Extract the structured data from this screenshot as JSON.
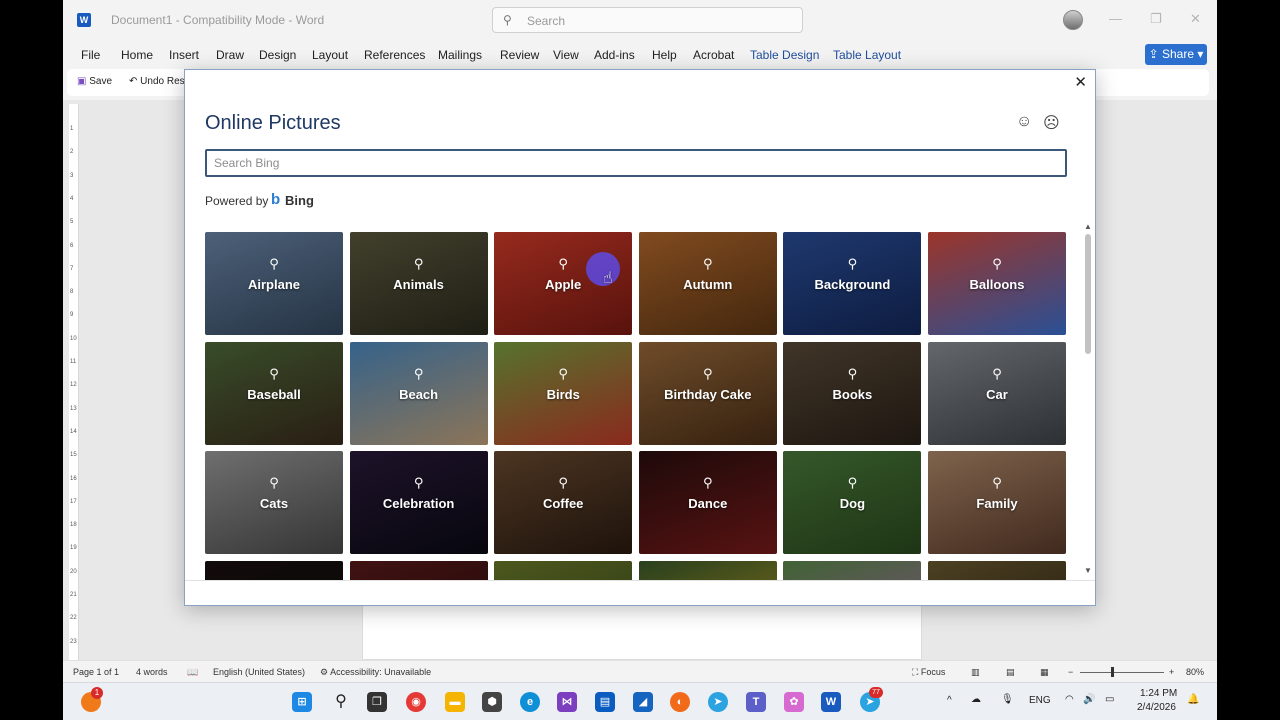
{
  "window": {
    "title": "Document1  -  Compatibility Mode  -  Word",
    "search_placeholder": "Search",
    "minimize": "—",
    "restore": "❐",
    "close": "✕"
  },
  "menu": {
    "items": [
      "File",
      "Home",
      "Insert",
      "Draw",
      "Design",
      "Layout",
      "References",
      "Mailings",
      "Review",
      "View",
      "Add-ins",
      "Help",
      "Acrobat"
    ],
    "context_tabs": [
      "Table Design",
      "Table Layout"
    ],
    "share_label": "Share"
  },
  "quick_toolbar": {
    "save_label": "Save",
    "undo_label": "Undo Res"
  },
  "ruler": {
    "ticks": [
      "1",
      "2",
      "3",
      "4",
      "5",
      "6",
      "7",
      "8",
      "9",
      "10",
      "11",
      "12",
      "13",
      "14",
      "15",
      "16",
      "17",
      "18",
      "19",
      "20",
      "21",
      "22",
      "23"
    ]
  },
  "dialog": {
    "title": "Online Pictures",
    "close_label": "✕",
    "smile_label": "☺",
    "frown_label": "☹",
    "search_placeholder": "Search Bing",
    "powered_by": "Powered by",
    "bing_label": "Bing",
    "magnifier": "⚲",
    "scroll_up": "▲",
    "scroll_down": "▼",
    "tiles": [
      {
        "label": "Airplane",
        "colors": [
          "#6b86a8",
          "#34485e"
        ]
      },
      {
        "label": "Animals",
        "colors": [
          "#5c5a3e",
          "#2b2a1d"
        ]
      },
      {
        "label": "Apple",
        "colors": [
          "#d13b2a",
          "#7a1a12"
        ]
      },
      {
        "label": "Autumn",
        "colors": [
          "#b3682c",
          "#5e3714"
        ]
      },
      {
        "label": "Background",
        "colors": [
          "#2a4f9a",
          "#14285a"
        ]
      },
      {
        "label": "Balloons",
        "colors": [
          "#d84a3a",
          "#3a6fd0"
        ]
      },
      {
        "label": "Baseball",
        "colors": [
          "#4e6b3a",
          "#3a2a1c"
        ]
      },
      {
        "label": "Beach",
        "colors": [
          "#4b89c0",
          "#c2a27a"
        ]
      },
      {
        "label": "Birds",
        "colors": [
          "#78a040",
          "#c03a2a"
        ]
      },
      {
        "label": "Birthday Cake",
        "colors": [
          "#9a6a3a",
          "#4a2e16"
        ]
      },
      {
        "label": "Books",
        "colors": [
          "#5a4a38",
          "#2a2018"
        ]
      },
      {
        "label": "Car",
        "colors": [
          "#8a8f96",
          "#3e4348"
        ]
      },
      {
        "label": "Cats",
        "colors": [
          "#9a9a9a",
          "#4a4a4a"
        ]
      },
      {
        "label": "Celebration",
        "colors": [
          "#2a1a3a",
          "#0a0a14"
        ]
      },
      {
        "label": "Coffee",
        "colors": [
          "#6a4a30",
          "#2a1a10"
        ]
      },
      {
        "label": "Dance",
        "colors": [
          "#2a0e0e",
          "#7a1a1a"
        ]
      },
      {
        "label": "Dog",
        "colors": [
          "#4a7a3a",
          "#2a4a1e"
        ]
      },
      {
        "label": "Family",
        "colors": [
          "#b08a6a",
          "#5a3a2a"
        ]
      },
      {
        "label": "",
        "colors": [
          "#1a1010",
          "#0a0a0a"
        ]
      },
      {
        "label": "",
        "colors": [
          "#5a1a1a",
          "#2a0a0a"
        ]
      },
      {
        "label": "",
        "colors": [
          "#6a7a2a",
          "#3a4a1a"
        ]
      },
      {
        "label": "",
        "colors": [
          "#3a5a2a",
          "#c0a020"
        ]
      },
      {
        "label": "",
        "colors": [
          "#5a8a4a",
          "#b06ab0"
        ]
      },
      {
        "label": "",
        "colors": [
          "#6a5a30",
          "#2a2010"
        ]
      }
    ]
  },
  "status": {
    "page": "Page 1 of 1",
    "words": "4 words",
    "language": "English (United States)",
    "accessibility": "Accessibility: Unavailable",
    "focus": "Focus",
    "zoom_minus": "−",
    "zoom_plus": "+",
    "zoom": "80%"
  },
  "taskbar": {
    "notification_badge": "1",
    "telegram_badge": "77",
    "chevron": "^",
    "language": "ENG",
    "time": "1:24 PM",
    "date": "2/4/2026"
  }
}
